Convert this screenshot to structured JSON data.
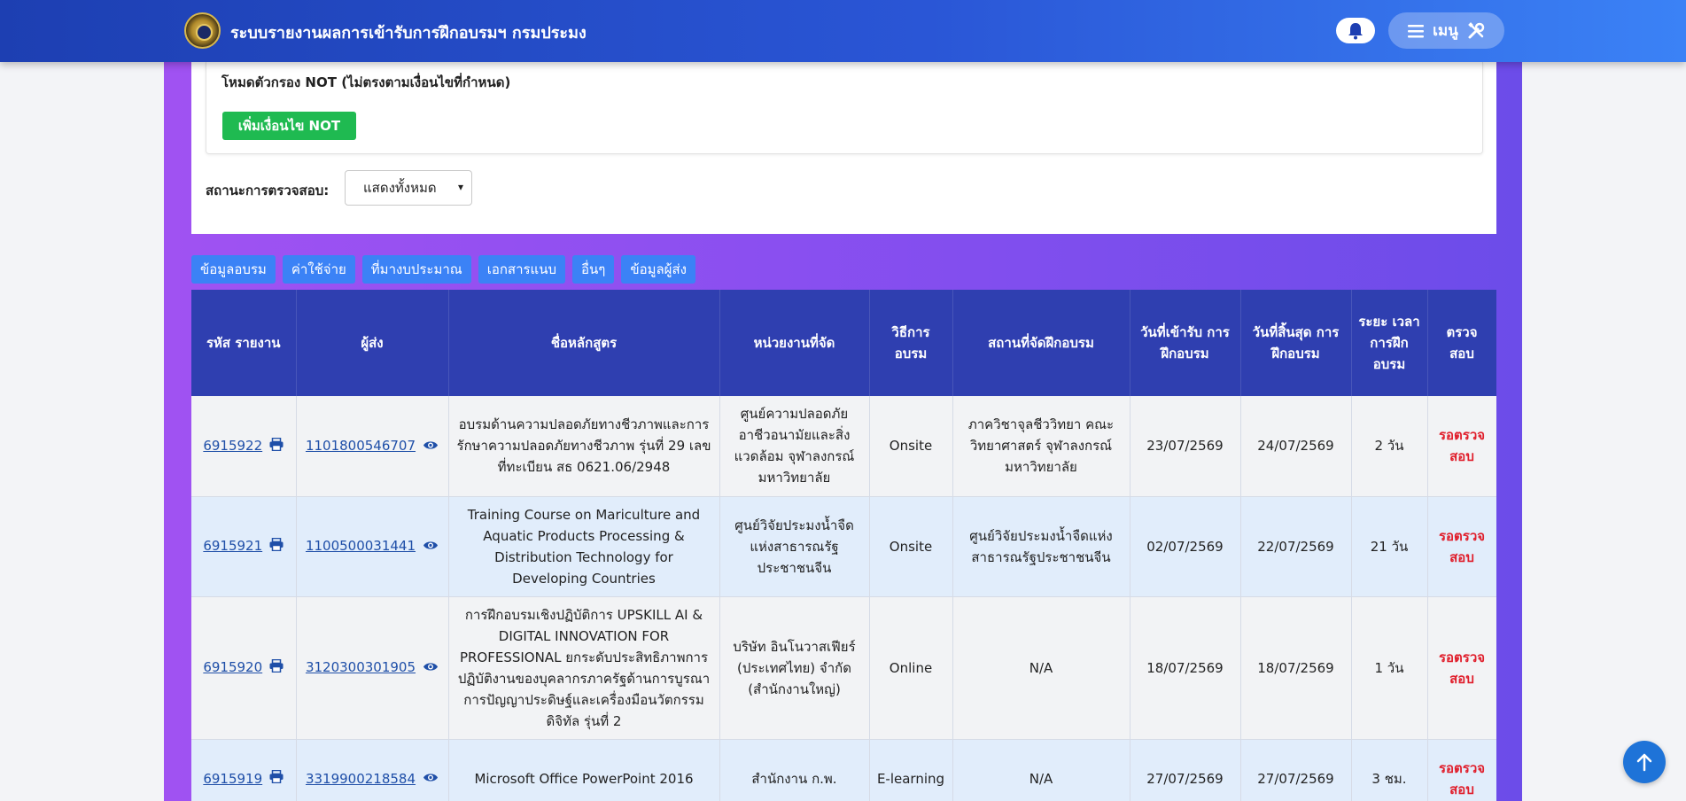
{
  "header": {
    "title": "ระบบรายงานผลการเข้ารับการฝึกอบรมฯ กรมประมง",
    "menu_label": "เมนู",
    "bell_icon": "bell-icon",
    "menu_icon": "hamburger-icon",
    "tools_icon": "tools-icon"
  },
  "filters": {
    "not_mode_label": "โหมดตัวกรอง NOT (ไม่ตรงตามเงื่อนไขที่กำหนด)",
    "add_not_button": "เพิ่มเงื่อนไข NOT",
    "status_label": "สถานะการตรวจสอบ:",
    "status_value": "แสดงทั้งหมด"
  },
  "tabs": [
    "ข้อมูลอบรม",
    "ค่าใช้จ่าย",
    "ที่มางบประมาณ",
    "เอกสารแนบ",
    "อื่นๆ",
    "ข้อมูลผู้ส่ง"
  ],
  "table": {
    "headers": [
      "รหัส รายงาน",
      "ผู้ส่ง",
      "ชื่อหลักสูตร",
      "หน่วยงานที่จัด",
      "วิธีการ อบรม",
      "สถานที่จัดฝึกอบรม",
      "วันที่เข้ารับ การฝึกอบรม",
      "วันที่สิ้นสุด การฝึกอบรม",
      "ระยะ เวลา การฝึก อบรม",
      "ตรวจ สอบ"
    ],
    "rows": [
      {
        "id": "6915922",
        "sender": "1101800546707",
        "course": "อบรมด้านความปลอดภัยทางชีวภาพและการรักษาความปลอดภัยทางชีวภาพ รุ่นที่ 29 เลขที่ทะเบียน สธ 0621.06/2948",
        "org": "ศูนย์ความปลอดภัยอาชีวอนามัยและสิ่งแวดล้อม จุฬาลงกรณ์มหาวิทยาลัย",
        "method": "Onsite",
        "place": "ภาควิชาจุลชีววิทยา คณะวิทยาศาสตร์ จุฬาลงกรณ์มหาวิทยาลัย",
        "start": "23/07/2569",
        "end": "24/07/2569",
        "duration": "2 วัน",
        "status": "รอตรวจสอบ"
      },
      {
        "id": "6915921",
        "sender": "1100500031441",
        "course": "Training Course on Mariculture and Aquatic Products Processing & Distribution Technology for Developing Countries",
        "org": "ศูนย์วิจัยประมงน้ำจืดแห่งสาธารณรัฐประชาชนจีน",
        "method": "Onsite",
        "place": "ศูนย์วิจัยประมงน้ำจืดแห่งสาธารณรัฐประชาชนจีน",
        "start": "02/07/2569",
        "end": "22/07/2569",
        "duration": "21 วัน",
        "status": "รอตรวจสอบ"
      },
      {
        "id": "6915920",
        "sender": "3120300301905",
        "course": "การฝึกอบรมเชิงปฏิบัติการ UPSKILL AI & DIGITAL INNOVATION FOR PROFESSIONAL ยกระดับประสิทธิภาพการปฏิบัติงานของบุคลากรภาครัฐด้านการบูรณาการปัญญาประดิษฐ์และเครื่องมือนวัตกรรมดิจิทัล รุ่นที่ 2",
        "org": "บริษัท อินโนวาสเฟียร์ (ประเทศไทย) จำกัด (สำนักงานใหญ่)",
        "method": "Online",
        "place": "N/A",
        "start": "18/07/2569",
        "end": "18/07/2569",
        "duration": "1 วัน",
        "status": "รอตรวจสอบ"
      },
      {
        "id": "6915919",
        "sender": "3319900218584",
        "course": "Microsoft Office PowerPoint 2016",
        "org": "สำนักงาน ก.พ.",
        "method": "E-learning",
        "place": "N/A",
        "start": "27/07/2569",
        "end": "27/07/2569",
        "duration": "3 ชม.",
        "status": "รอตรวจสอบ"
      }
    ]
  },
  "icons": {
    "print": "printer-icon",
    "view": "eye-icon",
    "scroll_top": "arrow-up-icon"
  },
  "colors": {
    "header_bar": "#2a56d6",
    "table_header": "#2f3fb0",
    "tab": "#3b82f6",
    "add_button": "#1fba51",
    "status_pending": "#e01e2b",
    "row_alt": "#e1edfb",
    "page_purple": "#8a4ff0"
  }
}
